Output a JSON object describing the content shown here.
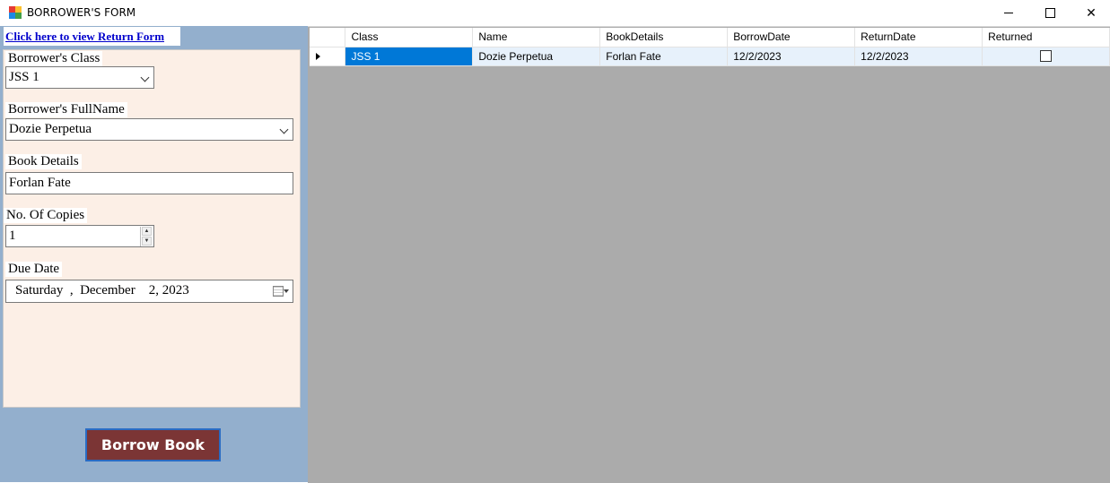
{
  "window": {
    "title": "BORROWER'S FORM",
    "icon": "app-icon"
  },
  "left": {
    "return_link": "Click here to view Return Form",
    "class_label": "Borrower's Class",
    "class_value": "JSS 1",
    "fullname_label": "Borrower's FullName",
    "fullname_value": "Dozie Perpetua",
    "book_label": "Book Details",
    "book_value": "Forlan Fate",
    "copies_label": "No. Of Copies",
    "copies_value": "1",
    "due_label": "Due Date",
    "due_value": "Saturday  ,  December    2, 2023",
    "borrow_button": "Borrow Book"
  },
  "grid": {
    "columns": [
      "Class",
      "Name",
      "BookDetails",
      "BorrowDate",
      "ReturnDate",
      "Returned"
    ],
    "rows": [
      {
        "Class": "JSS 1",
        "Name": "Dozie Perpetua",
        "BookDetails": "Forlan Fate",
        "BorrowDate": "12/2/2023",
        "ReturnDate": "12/2/2023",
        "Returned": false
      }
    ]
  },
  "colors": {
    "left_bg": "#93afcd",
    "form_bg": "#fcefe6",
    "button_bg": "#7b3535",
    "grid_bg": "#ababab",
    "selection": "#0078d7"
  }
}
